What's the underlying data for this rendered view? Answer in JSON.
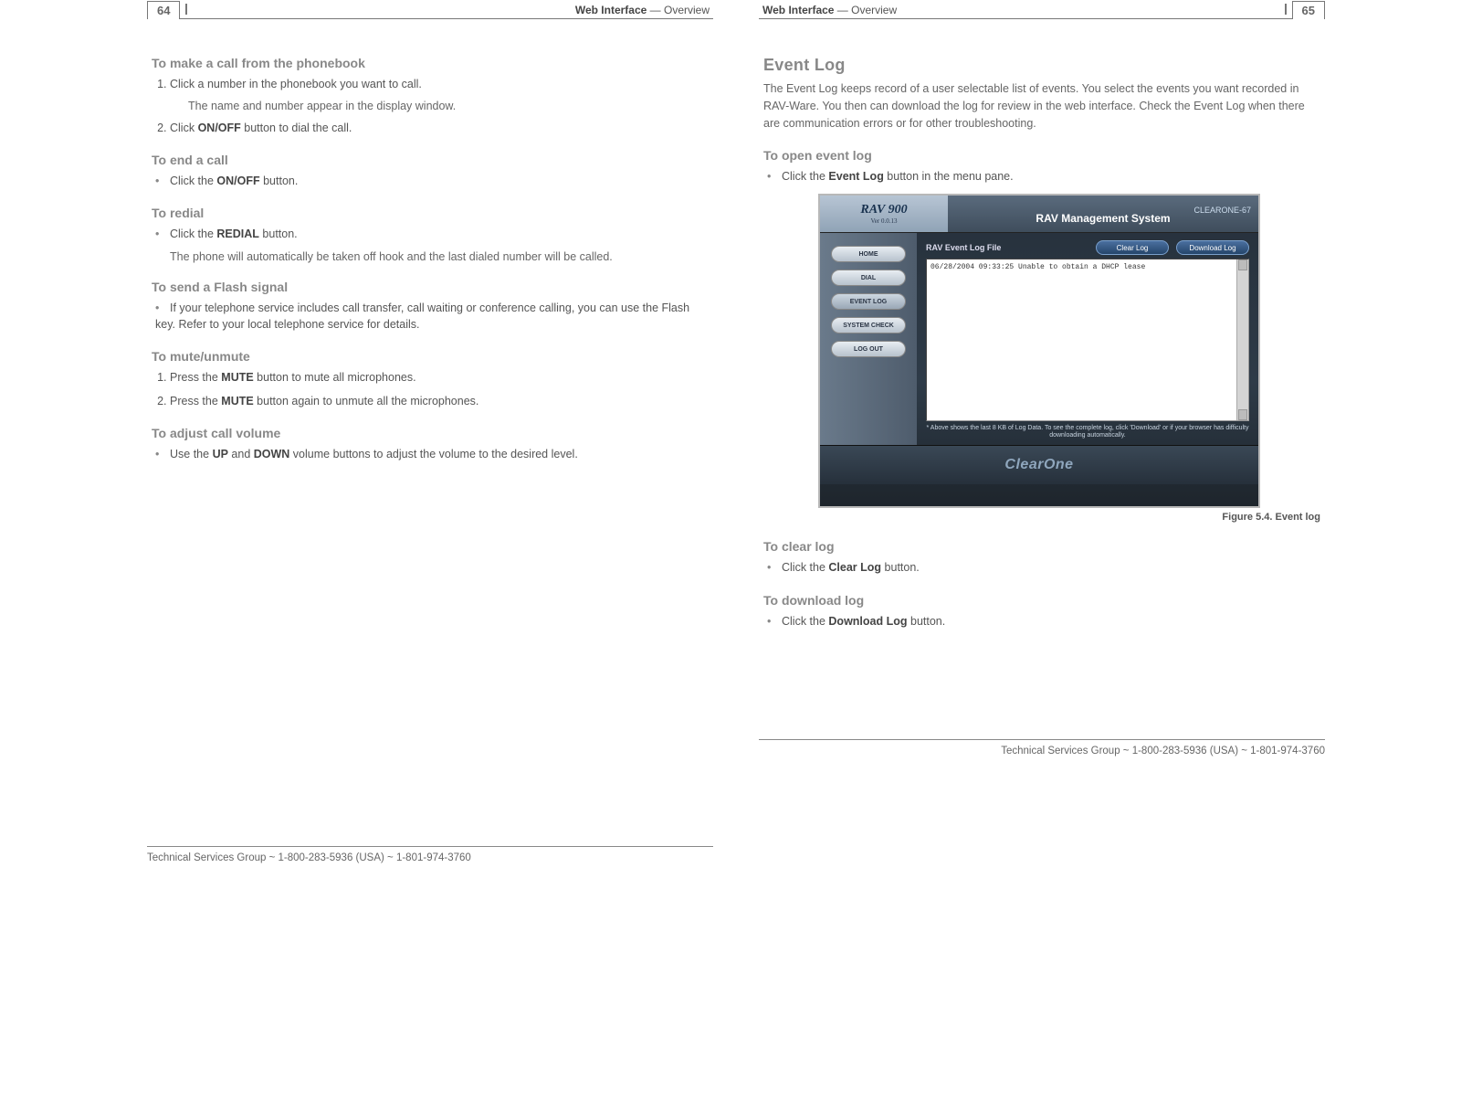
{
  "left": {
    "pageNum": "64",
    "header": {
      "bold": "Web Interface",
      "rest": " — Overview"
    },
    "sections": [
      {
        "heading": "To make a call from the phonebook",
        "olist": [
          {
            "pre": "Click a number in the phonebook you want to call.",
            "note": "The name and number appear in the display window."
          },
          {
            "pre": "Click ",
            "b": "ON/OFF",
            "post": " button to dial the call."
          }
        ]
      },
      {
        "heading": "To end a call",
        "ulist": [
          {
            "pre": "Click the ",
            "b": "ON/OFF",
            "post": " button."
          }
        ]
      },
      {
        "heading": "To redial",
        "ulist": [
          {
            "pre": "Click the ",
            "b": "REDIAL",
            "post": " button."
          }
        ],
        "after_note": "The phone will automatically be taken off hook and the last dialed number will be called."
      },
      {
        "heading": "To send a Flash signal",
        "ulist": [
          {
            "pre": "If your telephone service includes call transfer, call waiting or conference calling, you can use the Flash key. Refer to your local telephone service for details."
          }
        ]
      },
      {
        "heading": "To mute/unmute",
        "olist": [
          {
            "pre": "Press the ",
            "b": "MUTE",
            "post": " button to mute all microphones."
          },
          {
            "pre": "Press the ",
            "b": "MUTE",
            "post": " button again to unmute all the microphones."
          }
        ]
      },
      {
        "heading": "To adjust call volume",
        "ulist": [
          {
            "pre": "Use the ",
            "b": "UP",
            "post": " and ",
            "b2": "DOWN",
            "post2": " volume buttons to adjust the volume to the desired level."
          }
        ]
      }
    ],
    "footer": "Technical Services Group ~ 1-800-283-5936 (USA) ~ 1-801-974-3760"
  },
  "right": {
    "pageNum": "65",
    "header": {
      "bold": "Web Interface",
      "rest": " — Overview"
    },
    "title": "Event Log",
    "intro": "The Event Log keeps record of a user selectable list of events. You select the events you want recorded in RAV-Ware. You then can download the log for review in the web interface. Check the Event Log when there are communication errors or for other troubleshooting.",
    "open": {
      "heading": "To open event log",
      "item": {
        "pre": "Click the ",
        "b": "Event Log",
        "post": " button in the menu pane."
      }
    },
    "fig": {
      "logo": "RAV 900",
      "ver": "Ver 0.0.13",
      "hostname": "CLEARONE-67",
      "mgt": "RAV Management System",
      "menu": [
        "HOME",
        "DIAL",
        "EVENT LOG",
        "SYSTEM CHECK",
        "LOG OUT"
      ],
      "label": "RAV Event Log File",
      "btn_clear": "Clear Log",
      "btn_dl": "Download Log",
      "log_line": "06/28/2004 09:33:25    Unable to obtain a DHCP lease",
      "hint": "* Above shows the last 8 KB of Log Data. To see the complete log, click 'Download' or if your browser has difficulty downloading automatically.",
      "brand": "ClearOne",
      "caption": "Figure 5.4. Event log"
    },
    "clear": {
      "heading": "To clear log",
      "item": {
        "pre": "Click the ",
        "b": "Clear Log",
        "post": " button."
      }
    },
    "download": {
      "heading": "To download log",
      "item": {
        "pre": "Click the ",
        "b": "Download Log",
        "post": " button."
      }
    },
    "footer": "Technical Services Group ~ 1-800-283-5936 (USA) ~ 1-801-974-3760"
  }
}
